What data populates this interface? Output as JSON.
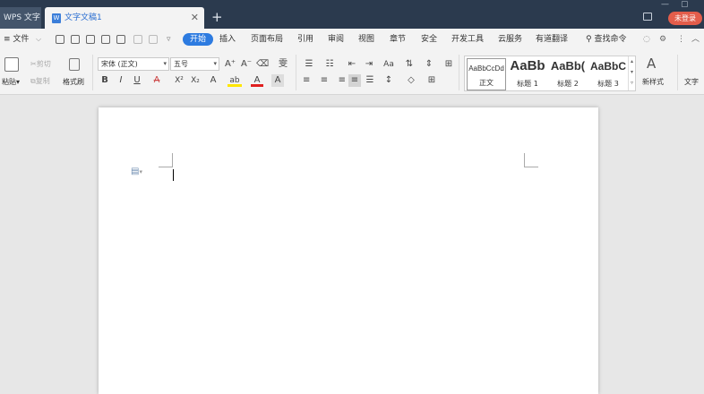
{
  "titlebar": {
    "app_tab": "WPS 文字",
    "doc_tab": "文字文稿1",
    "doc_icon": "W",
    "close_icon": "✕",
    "new_tab_icon": "+",
    "minimize_icon": "—",
    "maximize_icon": "▢",
    "login": "未登录"
  },
  "menubar": {
    "file": "≡ 文件",
    "file_arrow": "⌵",
    "redo_more": "▿",
    "tabs": [
      "开始",
      "插入",
      "页面布局",
      "引用",
      "审阅",
      "视图",
      "章节",
      "安全",
      "开发工具",
      "云服务",
      "有道翻译"
    ],
    "search": "查找命令",
    "search_icon": "⚲",
    "chat_icon": "◌",
    "settings_icon": "⚙",
    "more_icon": "⋮",
    "collapse_icon": "︿"
  },
  "ribbon": {
    "paste": "粘贴",
    "paste_arrow": "▾",
    "cut": "剪切",
    "copy": "复制",
    "format_painter": "格式刷",
    "font_name": "宋体 (正文)",
    "font_size": "五号",
    "grow_font": "A⁺",
    "shrink_font": "A⁻",
    "clear_format": "⌫",
    "phonetic": "雯",
    "bold": "B",
    "italic": "I",
    "underline": "U",
    "strikethrough": "A",
    "superscript": "X²",
    "subscript": "X₂",
    "text_effect": "A",
    "highlight": "ab",
    "font_color": "A",
    "char_shading": "A",
    "bullets": "☰",
    "numbering": "☷",
    "decrease_indent": "⇤",
    "increase_indent": "⇥",
    "change_case": "Aa",
    "sort": "⇅",
    "line_spacing_tool": "⇕",
    "table_tool": "⊞",
    "align_left": "≡",
    "align_center": "≡",
    "align_right": "≡",
    "justify": "≡",
    "distribute": "☰",
    "para_spacing": "↕",
    "shading": "◇",
    "borders": "⊞",
    "styles": [
      {
        "sample": "AaBbCcDd",
        "name": "正文"
      },
      {
        "sample": "AaBb",
        "name": "标题 1"
      },
      {
        "sample": "AaBb(",
        "name": "标题 2"
      },
      {
        "sample": "AaBbC",
        "name": "标题 3"
      }
    ],
    "new_style": "新样式",
    "text_tools": "文字"
  },
  "document": {
    "para_icon": "▤"
  },
  "colors": {
    "titlebar": "#2b3a4e",
    "accent": "#2d7be0",
    "login": "#e35d4b",
    "font_color_bar": "#e02020",
    "highlight_bar": "#ffe600"
  }
}
